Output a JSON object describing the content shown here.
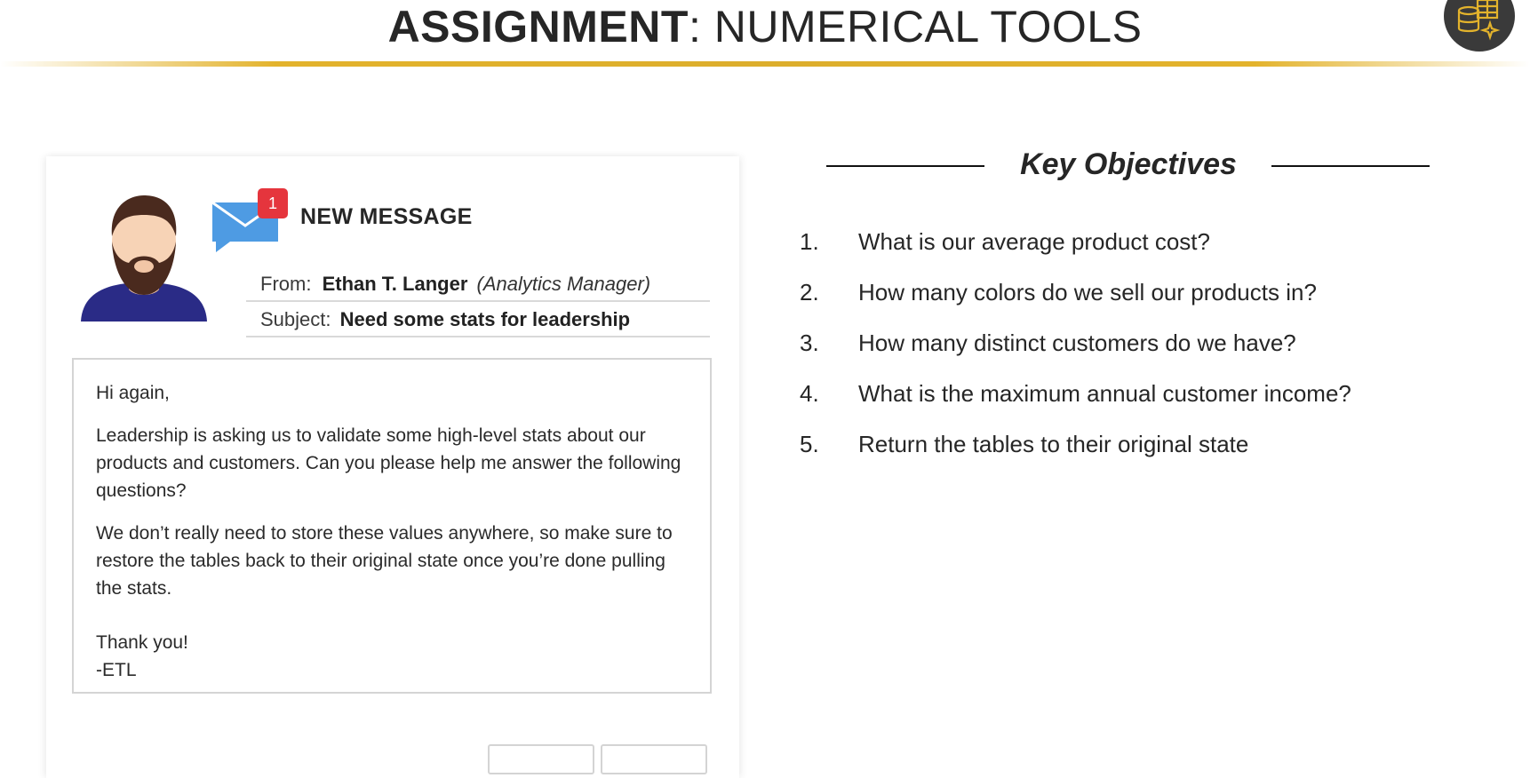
{
  "header": {
    "title_bold": "ASSIGNMENT",
    "title_rest": ": NUMERICAL TOOLS",
    "accent_color": "#e3b32c",
    "badge_icon": "database-sparkle-icon"
  },
  "message": {
    "heading": "NEW MESSAGE",
    "notification_count": "1",
    "from_label": "From:",
    "from_name": "Ethan T. Langer",
    "from_role": "(Analytics Manager)",
    "subject_label": "Subject:",
    "subject": "Need some stats for leadership",
    "greeting": "Hi again,",
    "paragraph1": "Leadership is asking us to validate some high-level stats about our products and customers. Can you please help me answer the following questions?",
    "paragraph2": "We don’t really need to store these values anywhere, so make sure to restore the tables back to their original state once you’re done pulling the stats.",
    "signoff": "Thank you!",
    "signature": "-ETL"
  },
  "objectives": {
    "title": "Key Objectives",
    "items": [
      {
        "num": "1.",
        "text": "What is our average product cost?"
      },
      {
        "num": "2.",
        "text": "How many colors do we sell our products in?"
      },
      {
        "num": "3.",
        "text": "How many distinct customers do we have?"
      },
      {
        "num": "4.",
        "text": "What is the maximum annual customer income?"
      },
      {
        "num": "5.",
        "text": "Return the tables to their original state"
      }
    ]
  }
}
